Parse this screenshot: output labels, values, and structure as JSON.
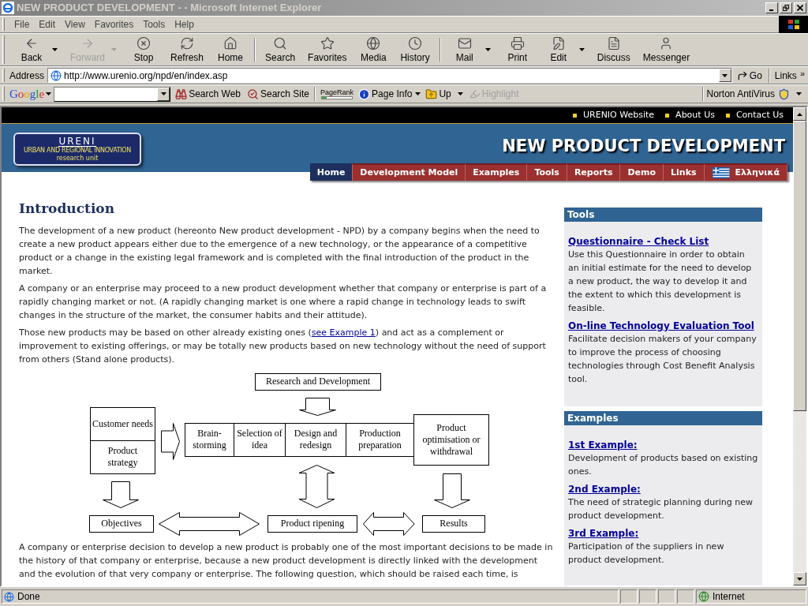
{
  "window": {
    "title": "NEW PRODUCT DEVELOPMENT - - Microsoft Internet Explorer"
  },
  "menu": [
    "File",
    "Edit",
    "View",
    "Favorites",
    "Tools",
    "Help"
  ],
  "toolbar": [
    [
      {
        "kind": "back",
        "label": "Back",
        "dropdown": true,
        "disabled": false
      },
      {
        "kind": "forward",
        "label": "Forward",
        "dropdown": true,
        "disabled": true
      },
      {
        "kind": "stop",
        "label": "Stop",
        "dropdown": false,
        "disabled": false
      },
      {
        "kind": "refresh",
        "label": "Refresh",
        "dropdown": false,
        "disabled": false
      },
      {
        "kind": "home",
        "label": "Home",
        "dropdown": false,
        "disabled": false
      }
    ],
    [
      {
        "kind": "search",
        "label": "Search",
        "dropdown": false,
        "disabled": false
      },
      {
        "kind": "favorites",
        "label": "Favorites",
        "dropdown": false,
        "disabled": false
      },
      {
        "kind": "media",
        "label": "Media",
        "dropdown": false,
        "disabled": false
      },
      {
        "kind": "history",
        "label": "History",
        "dropdown": false,
        "disabled": false
      }
    ],
    [
      {
        "kind": "mail",
        "label": "Mail",
        "dropdown": true,
        "disabled": false
      },
      {
        "kind": "print",
        "label": "Print",
        "dropdown": false,
        "disabled": false
      },
      {
        "kind": "edit",
        "label": "Edit",
        "dropdown": true,
        "disabled": false
      },
      {
        "kind": "discuss",
        "label": "Discuss",
        "dropdown": false,
        "disabled": false
      },
      {
        "kind": "messenger",
        "label": "Messenger",
        "dropdown": false,
        "disabled": false
      }
    ]
  ],
  "address": {
    "label": "Address",
    "url": "http://www.urenio.org/npd/en/index.asp",
    "go": "Go",
    "links": "Links",
    "more": "»"
  },
  "google_bar": {
    "logo": "Google",
    "search_web": "Search Web",
    "search_site": "Search Site",
    "pagerank": {
      "label": "PageRank",
      "level": 0.15
    },
    "page_info": "Page Info",
    "up": "Up",
    "highlight": {
      "label": "Highlight",
      "disabled": true
    },
    "antivirus": "Norton AntiVirus"
  },
  "page": {
    "top_links": [
      "URENIO Website",
      "About Us",
      "Contact Us"
    ],
    "logo": {
      "name": "URENI",
      "line1": "URBAN AND REGIONAL INNOVATION",
      "line2": "research unit"
    },
    "title": "NEW PRODUCT DEVELOPMENT",
    "nav": [
      {
        "kind": "link",
        "label": "Home",
        "selected": true
      },
      {
        "kind": "link",
        "label": "Development Model",
        "selected": false
      },
      {
        "kind": "link",
        "label": "Examples",
        "selected": false
      },
      {
        "kind": "link",
        "label": "Tools",
        "selected": false
      },
      {
        "kind": "link",
        "label": "Reports",
        "selected": false
      },
      {
        "kind": "link",
        "label": "Demo",
        "selected": false
      },
      {
        "kind": "link",
        "label": "Links",
        "selected": false
      },
      {
        "kind": "language",
        "label": "Ελληνικά",
        "selected": false
      }
    ],
    "heading": "Introduction",
    "paragraphs": [
      {
        "text": "The development of a new product (hereonto New product development - NPD) by a company begins when the need to create a new product appears either due to the emergence of a new technology, or the appearance of a competitive product or a change in the existing legal framework and is completed with the final introduction of the product in the market."
      },
      {
        "text": "A company or an enterprise may proceed to a new product development whether that company or enterprise is part of a rapidly changing market or not. (A rapidly changing market is one where a rapid change in technology leads to swift changes in the structure of the market, the consumer habits and their attitude)."
      },
      {
        "text": "Those new products may be based on other already existing ones (",
        "link": "see Example 1",
        "after": ") and act as a complement or improvement to existing offerings, or may be totally new products based on new technology without the need of support from others (Stand alone products)."
      }
    ],
    "diagram": {
      "top": "Research and Development",
      "inputs": [
        "Customer needs",
        "Product strategy"
      ],
      "steps": [
        "Brain-storming",
        "Selection of idea",
        "Design and redesign",
        "Production preparation"
      ],
      "outcome": "Product optimisation or withdrawal",
      "bottom": [
        "Objectives",
        "Product ripening",
        "Results"
      ]
    },
    "closing": "A company or enterprise decision to develop a new product is probably one of the most important decisions to be made in the history of that company or enterprise, because a new product development is directly linked with the development and the evolution of that very company or enterprise. The following question, which should be raised each time, is",
    "sidebar": [
      {
        "title": "Tools",
        "items": [
          {
            "link": "Questionnaire - Check List",
            "text": "Use this Questionnaire in order to obtain an initial estimate for the need to develop a new product, the way to develop it and the extent to which this development is feasible."
          },
          {
            "link": "On-line Technology Evaluation Tool",
            "text": "Facilitate decision makers of your company to improve the process of choosing technologies through Cost Benefit Analysis tool."
          }
        ]
      },
      {
        "title": "Examples",
        "items": [
          {
            "link": "1st Example:",
            "text": "Development of products based on existing ones."
          },
          {
            "link": "2nd Example:",
            "text": "The need of strategic planning during new product development."
          },
          {
            "link": "3rd Example:",
            "text": "Participation of the suppliers in new product development."
          }
        ]
      }
    ]
  },
  "status_bar": {
    "text": "Done",
    "zone": "Internet"
  }
}
